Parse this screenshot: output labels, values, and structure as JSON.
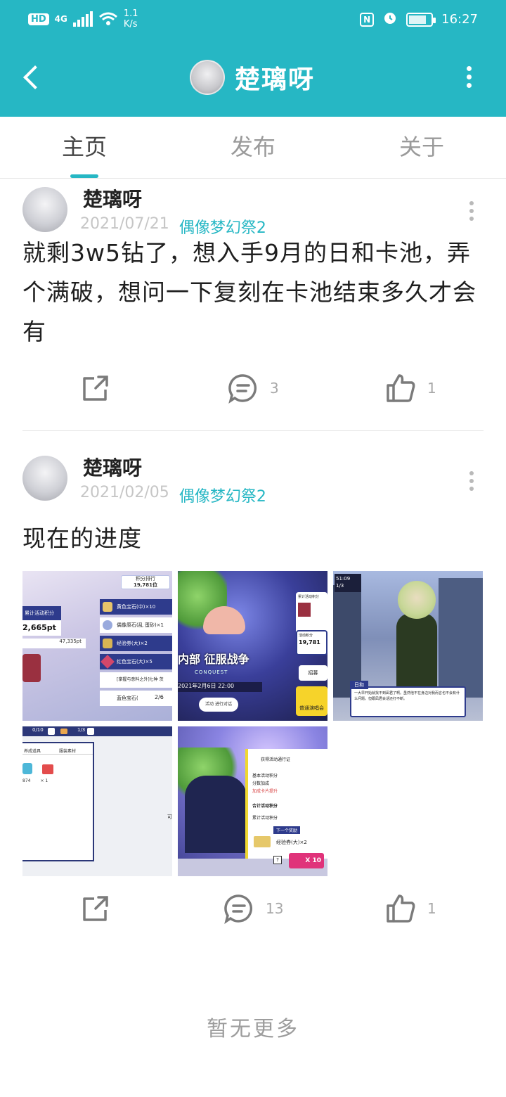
{
  "status_bar": {
    "hd": "HD",
    "network": "4G",
    "speed": "1.1\nK/s",
    "time": "16:27"
  },
  "header": {
    "title": "楚璃呀"
  },
  "tabs": [
    {
      "label": "主页",
      "active": true
    },
    {
      "label": "发布",
      "active": false
    },
    {
      "label": "关于",
      "active": false
    }
  ],
  "posts": [
    {
      "author": "楚璃呀",
      "date": "2021/07/21",
      "tag": "偶像梦幻祭2",
      "text": "就剩3w5钻了，想入手9月的日和卡池，弄个满破，想问一下复刻在卡池结束多久才会有",
      "comments": "3",
      "likes": "1"
    },
    {
      "author": "楚璃呀",
      "date": "2021/02/05",
      "tag": "偶像梦幻祭2",
      "text": "现在的进度",
      "comments": "13",
      "likes": "1",
      "images": [
        {
          "title": "积分排行",
          "rank": "19,781位",
          "pts1": "2,665pt",
          "pts2": "47,335pt",
          "items": [
            "黄色宝石(中)×10",
            "偶像原石(乱 蛋砂)×1",
            "经验券(大)×2",
            "红色宝石(大)×5",
            "[掌握与意料之外]七种 茨",
            "蓝色宝石("
          ],
          "counter": "2/6"
        },
        {
          "title": "内部 征服战争",
          "subtitle": "CONQUEST",
          "date": "2021年2月6日 22:00",
          "label_a": "累计活动积分",
          "label_b": "活动积分",
          "rank": "19,781",
          "btn1": "活动 进行对话",
          "btn2": "招募",
          "btn3": "普通演唱会"
        },
        {
          "time": "51:09",
          "counter": "1/3",
          "speaker": "日和",
          "dialog": "一大早开始就找不到凪君了啊。虽然他不在身边对我而言也不会有什么问题，但跟凪君会话还打不断。"
        },
        {
          "counter1": "0/10",
          "counter2": "1/3",
          "tab1": "养成道具",
          "tab2": "服装素材",
          "qty1": "874",
          "qty2": "1"
        },
        {
          "row1": "获得活动通行证",
          "row2": "基本活动积分",
          "row3": "分数加成",
          "row4": "加成卡片提升",
          "row5": "合计活动积分",
          "row6": "累计活动积分",
          "next": "下一个奖励",
          "reward": "经验券(大)×2",
          "multi": "X 10"
        }
      ]
    }
  ],
  "footer": {
    "no_more": "暂无更多"
  }
}
